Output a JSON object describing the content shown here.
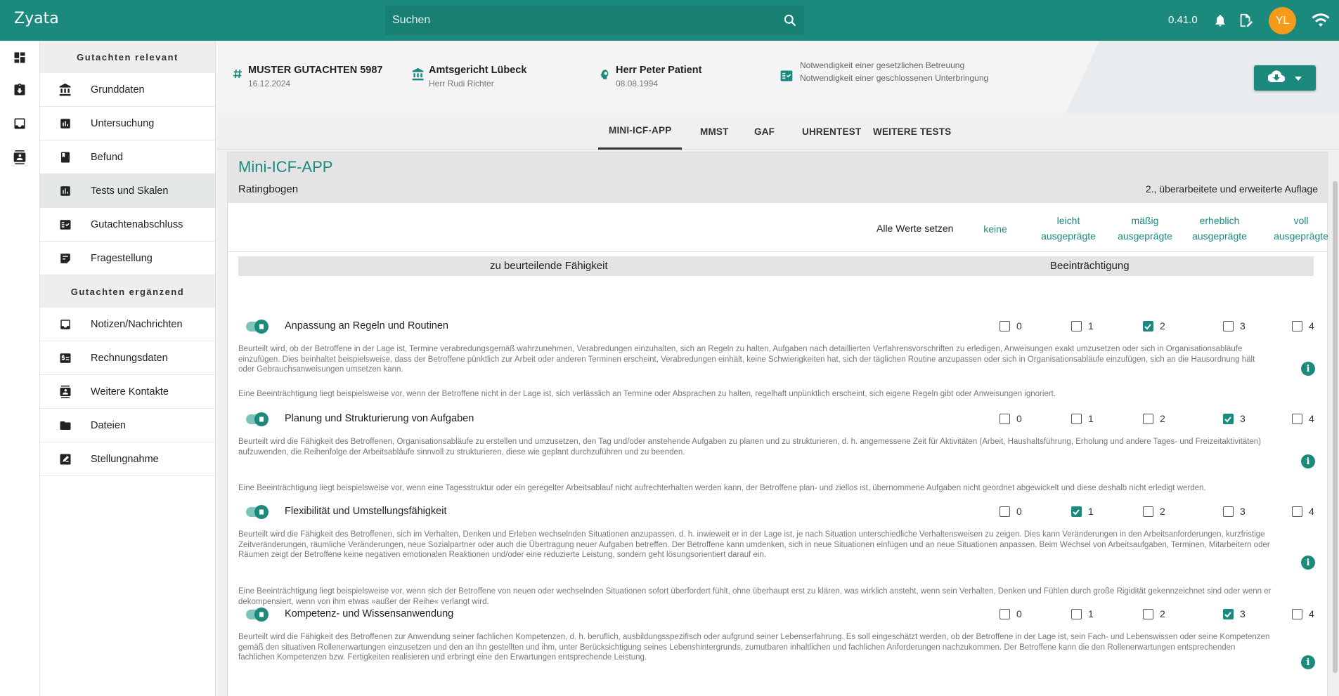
{
  "app": {
    "brand": "Zyata",
    "version": "0.41.0",
    "avatar_initials": "YL",
    "accent": "#1b8a7d",
    "avatar_color": "#f59b1b"
  },
  "search": {
    "placeholder": "Suchen"
  },
  "rail": {
    "icons": [
      "dashboard-icon",
      "clipboard-download-icon",
      "inbox-icon",
      "contacts-icon"
    ]
  },
  "sidebar": {
    "section1": "Gutachten relevant",
    "items1": [
      {
        "label": "Grunddaten",
        "icon": "bank-icon"
      },
      {
        "label": "Untersuchung",
        "icon": "chart-icon"
      },
      {
        "label": "Befund",
        "icon": "book-icon"
      },
      {
        "label": "Tests und Skalen",
        "icon": "chart-icon",
        "active": true
      },
      {
        "label": "Gutachtenabschluss",
        "icon": "checklist-icon"
      },
      {
        "label": "Fragestellung",
        "icon": "note-icon"
      }
    ],
    "section2": "Gutachten ergänzend",
    "items2": [
      {
        "label": "Notizen/Nachrichten",
        "icon": "inbox-icon"
      },
      {
        "label": "Rechnungsdaten",
        "icon": "invoice-icon"
      },
      {
        "label": "Weitere Kontakte",
        "icon": "contact-icon"
      },
      {
        "label": "Dateien",
        "icon": "folder-icon"
      },
      {
        "label": "Stellungnahme",
        "icon": "signature-icon"
      }
    ]
  },
  "header": {
    "case": {
      "title": "MUSTER GUTACHTEN 5987",
      "sub": "16.12.2024"
    },
    "court": {
      "title": "Amtsgericht Lübeck",
      "sub": "Herr Rudi Richter"
    },
    "patient": {
      "title": "Herr Peter Patient",
      "sub": "08.08.1994"
    },
    "notes": [
      "Notwendigkeit einer gesetzlichen Betreuung",
      "Notwendigkeit einer geschlossenen Unterbringung"
    ]
  },
  "tabs": [
    "MINI-ICF-APP",
    "MMST",
    "GAF",
    "UHRENTEST",
    "WEITERE TESTS"
  ],
  "card": {
    "title": "Mini-ICF-APP",
    "subtitle": "Ratingbogen",
    "edition": "2., überarbeitete und erweiterte Auflage",
    "set_all": "Alle Werte setzen",
    "levels": [
      {
        "l1": "keine",
        "l2": ""
      },
      {
        "l1": "leicht",
        "l2": "ausgeprägte"
      },
      {
        "l1": "mäßig",
        "l2": "ausgeprägte"
      },
      {
        "l1": "erheblich",
        "l2": "ausgeprägte"
      },
      {
        "l1": "voll",
        "l2": "ausgeprägte"
      }
    ],
    "col_ability": "zu beurteilende Fähigkeit",
    "col_impairment": "Beeinträchtigung",
    "items": [
      {
        "title": "Anpassung an Regeln und Routinen",
        "selected": 2,
        "desc1": "Beurteilt wird, ob der Betroffene in der Lage ist, Termine verabredungsgemäß wahrzunehmen, Verabredungen einzuhalten, sich an Regeln zu halten, Aufgaben nach detaillierten Verfahrensvorschriften zu erledigen, Anweisungen exakt umzusetzen oder sich in Organisationsabläufe einzufügen. Dies beinhaltet beispielsweise, dass der Betroffene pünktlich zur Arbeit oder anderen Terminen erscheint, Verabredungen einhält, keine Schwierigkeiten hat, sich der täglichen Routine anzupassen oder sich in Organisationsabläufe einzufügen, sich an die Hausordnung hält oder Gebrauchsanweisungen umsetzen kann.",
        "desc2": "Eine Beeinträchtigung liegt beispielsweise vor, wenn der Betroffene nicht in der Lage ist, sich verlässlich an Termine oder Absprachen zu halten, regelhaft unpünktlich erscheint, sich eigene Regeln gibt oder Anweisungen ignoriert."
      },
      {
        "title": "Planung und Strukturierung von Aufgaben",
        "selected": 3,
        "desc1": "Beurteilt wird die Fähigkeit des Betroffenen, Organisationsabläufe zu erstellen und umzusetzen, den Tag und/oder anstehende Aufgaben zu planen und zu strukturieren, d. h. angemessene Zeit für Aktivitäten (Arbeit, Haushaltsführung, Erholung und andere Tages- und Freizeitaktivitäten) aufzuwenden, die Reihenfolge der Arbeitsabläufe sinnvoll zu strukturieren, diese wie geplant durchzuführen und zu beenden.",
        "desc2": "Eine Beeinträchtigung liegt beispielsweise vor, wenn eine Tagesstruktur oder ein geregelter Arbeitsablauf nicht aufrechterhalten werden kann, der Betroffene plan- und ziellos ist, übernommene Aufgaben nicht geordnet abgewickelt und diese deshalb nicht erledigt werden."
      },
      {
        "title": "Flexibilität und Umstellungsfähigkeit",
        "selected": 1,
        "desc1": "Beurteilt wird die Fähigkeit des Betroffenen, sich im Verhalten, Denken und Erleben wechselnden Situationen anzupassen, d. h. inwieweit er in der Lage ist, je nach Situation unterschiedliche Verhaltensweisen zu zeigen. Dies kann Veränderungen in den Arbeitsanforderungen, kurzfristige Zeitveränderungen, räumliche Veränderungen, neue Sozialpartner oder auch die Übertragung neuer Aufgaben betreffen. Der Betroffene kann umdenken, sich in neue Situationen einfügen und an neue Situationen anpassen. Beim Wechsel von Arbeitsaufgaben, Terminen, Mitarbeitern oder Räumen zeigt der Betroffene keine negativen emotionalen Reaktionen und/oder eine reduzierte Leistung, sondern geht lösungsorientiert darauf ein.",
        "desc2": "Eine Beeinträchtigung liegt beispielsweise vor, wenn sich der Betroffene von neuen oder wechselnden Situationen sofort überfordert fühlt, ohne überhaupt erst zu klären, was wirklich ansteht, wenn sein Verhalten, Denken und Fühlen durch große Rigidität gekennzeichnet sind oder wenn er dekompensiert, wenn von ihm etwas »außer der Reihe« verlangt wird."
      },
      {
        "title": "Kompetenz- und Wissensanwendung",
        "selected": 3,
        "desc1": "Beurteilt wird die Fähigkeit des Betroffenen zur Anwendung seiner fachlichen Kompetenzen, d. h. beruflich, ausbildungsspezifisch oder aufgrund seiner Lebenserfahrung. Es soll eingeschätzt werden, ob der Betroffene in der Lage ist, sein Fach- und Lebenswissen oder seine Kompetenzen gemäß den situativen Rollenerwartungen einzusetzen und den an ihn gestellten und ihm, unter Berücksichtigung seines Lebenshintergrunds, zumutbaren inhaltlichen und fachlichen Anforderungen nachzukommen. Der Betroffene kann die den Rollenerwartungen entsprechenden fachlichen Kompetenzen bzw. Fertigkeiten realisieren und erbringt eine den Erwartungen entsprechende Leistung.",
        "desc2": ""
      }
    ]
  }
}
